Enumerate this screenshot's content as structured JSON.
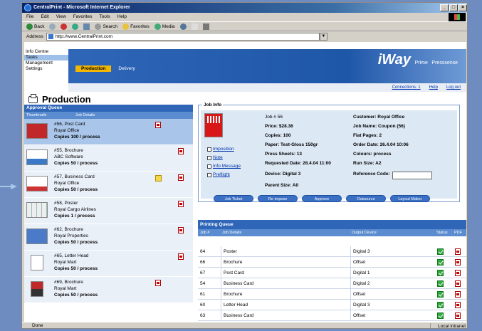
{
  "window": {
    "title": "CentralPrint - Microsoft Internet Explorer"
  },
  "menubar": {
    "items": [
      "File",
      "Edit",
      "View",
      "Favorites",
      "Tools",
      "Help"
    ]
  },
  "toolbar": {
    "back": "Back",
    "search": "Search",
    "favorites": "Favorites",
    "media": "Media"
  },
  "addressbar": {
    "label": "Address",
    "url": "http://www.CentralPrint.com"
  },
  "leftnav": {
    "items": [
      "Info Centre",
      "Tasks",
      "Management",
      "Settings"
    ]
  },
  "tabs": {
    "production": "Production",
    "delivery": "Delivery"
  },
  "brand": {
    "main": "iWay",
    "sub": "Prime",
    "partner": "Presssense"
  },
  "topbar": {
    "connections": "Connections: 1",
    "help": "Help",
    "logout": "Log out"
  },
  "page": {
    "title": "Production"
  },
  "approval_queue": {
    "title": "Approval Queue",
    "col_thumbnails": "Thumbnails",
    "col_details": "Job Details",
    "items": [
      {
        "line1": "#56, Post Card",
        "line2": "Royal Office",
        "line3": "Copies 100 / process"
      },
      {
        "line1": "#55, Brochure",
        "line2": "ABC Software",
        "line3": "Copies 50 / process"
      },
      {
        "line1": "#57, Business Card",
        "line2": "Royal Office",
        "line3": "Copies 50 / process"
      },
      {
        "line1": "#58, Poster",
        "line2": "Royal Cargo Airlines",
        "line3": "Copies 1 / process"
      },
      {
        "line1": "#62, Brochure",
        "line2": "Royal Properties",
        "line3": "Copies 50 / process"
      },
      {
        "line1": "#65, Letter Head",
        "line2": "Royal Mart",
        "line3": "Copies 50 / process"
      },
      {
        "line1": "#69, Brochure",
        "line2": "Royal Mart",
        "line3": "Copies 50 / process"
      }
    ]
  },
  "job_info": {
    "title": "Job Info",
    "links": [
      "Imposition",
      "Note",
      "Info Message",
      "Preflight"
    ],
    "job": "Job # 56",
    "price": "Price: $28.36",
    "copies": "Copies: 100",
    "paper": "Paper: Test-Gloss 150gr",
    "sheets": "Press Sheets: 13",
    "requested": "Requested Date: 28.4.04 11:00",
    "device": "Device: Digital 3",
    "parent": "Parent Size: A0",
    "customer": "Customer: Royal Office",
    "job_name": "Job Name: Coupon (56)",
    "flat_pages": "Flat Pages: 2",
    "order_date": "Order Date: 26.4.04 10:06",
    "colours": "Colours: process",
    "run_size": "Run Size: A2",
    "reference_code": "Reference Code:",
    "buttons": [
      "Job Ticket",
      "Re-impose",
      "Approve",
      "Outsource",
      "Layout Maker"
    ]
  },
  "printing_queue": {
    "title": "Printing Queue",
    "col_job": "Job #",
    "col_details": "Job Details",
    "col_device": "Output Device",
    "col_status": "Status",
    "col_pdf": "PDF",
    "rows": [
      {
        "job": "64",
        "details": "Poster",
        "device": "Digital 3"
      },
      {
        "job": "66",
        "details": "Brochure",
        "device": "Offset"
      },
      {
        "job": "67",
        "details": "Post Card",
        "device": "Digital 1"
      },
      {
        "job": "54",
        "details": "Business Card",
        "device": "Digital 2"
      },
      {
        "job": "61",
        "details": "Brochure",
        "device": "Offset"
      },
      {
        "job": "60",
        "details": "Letter Head",
        "device": "Digital 3"
      },
      {
        "job": "63",
        "details": "Business Card",
        "device": "Offset"
      }
    ]
  },
  "statusbar": {
    "left": "Done",
    "zone": "Local intranet"
  }
}
